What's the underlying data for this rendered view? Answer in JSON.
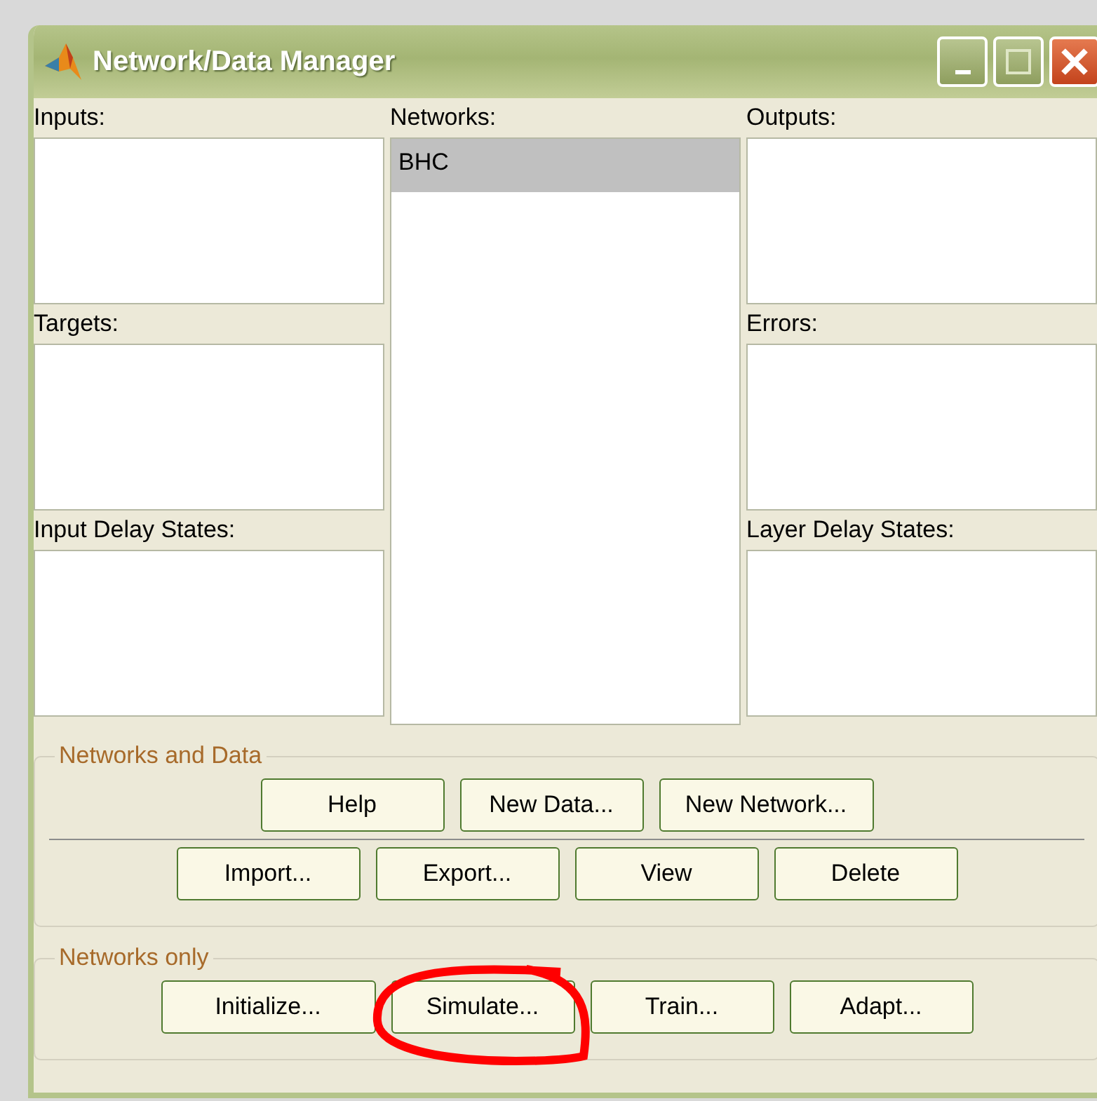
{
  "window": {
    "title": "Network/Data Manager"
  },
  "columns": [
    [
      {
        "label": "Inputs:"
      },
      {
        "label": "Targets:"
      },
      {
        "label": "Input Delay States:"
      }
    ],
    [
      {
        "label": "Networks:",
        "items": [
          {
            "text": "BHC",
            "selected": true
          }
        ]
      }
    ],
    [
      {
        "label": "Outputs:"
      },
      {
        "label": "Errors:"
      },
      {
        "label": "Layer Delay States:"
      }
    ]
  ],
  "groups": [
    {
      "title": "Networks and Data",
      "rows": [
        [
          {
            "label": "Help"
          },
          {
            "label": "New Data..."
          },
          {
            "label": "New Network..."
          }
        ],
        [
          {
            "label": "Import..."
          },
          {
            "label": "Export..."
          },
          {
            "label": "View"
          },
          {
            "label": "Delete"
          }
        ]
      ]
    },
    {
      "title": "Networks only",
      "rows": [
        [
          {
            "label": "Initialize..."
          },
          {
            "label": "Simulate...",
            "highlighted": true
          },
          {
            "label": "Train..."
          },
          {
            "label": "Adapt..."
          }
        ]
      ]
    }
  ]
}
